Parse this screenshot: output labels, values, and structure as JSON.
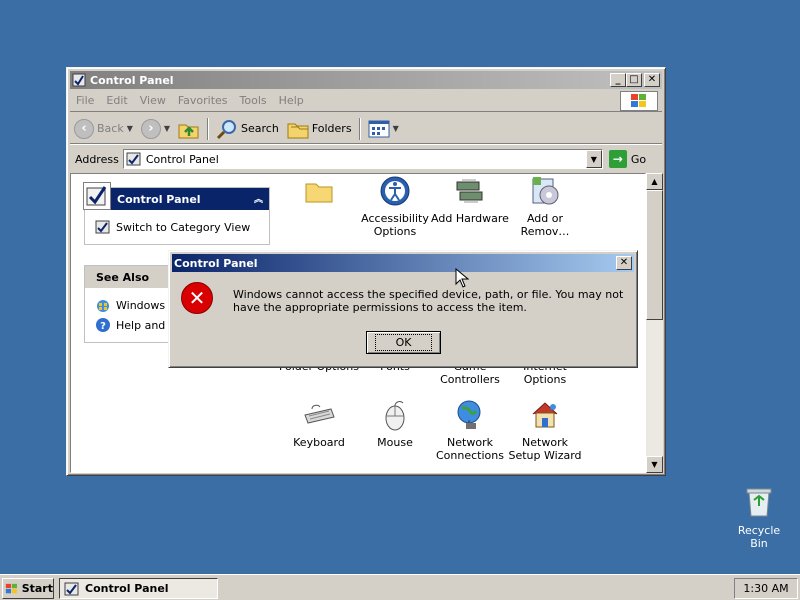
{
  "window": {
    "title": "Control Panel",
    "controls": {
      "minimize": "_",
      "maximize": "□",
      "close": "✕"
    }
  },
  "menu": [
    "File",
    "Edit",
    "View",
    "Favorites",
    "Tools",
    "Help"
  ],
  "toolbar": {
    "back": "Back",
    "search": "Search",
    "folders": "Folders"
  },
  "address": {
    "label": "Address",
    "value": "Control Panel",
    "go": "Go"
  },
  "task_panes": {
    "control_panel": {
      "title": "Control Panel",
      "link": "Switch to Category View"
    },
    "see_also": {
      "title": "See Also",
      "links": [
        "Windows U",
        "Help and S"
      ]
    }
  },
  "items": [
    {
      "label": "",
      "icon": "folder-icon"
    },
    {
      "label": "Accessibility Options",
      "icon": "accessibility-icon"
    },
    {
      "label": "Add Hardware",
      "icon": "add-hardware-icon"
    },
    {
      "label": "Add or Remov…",
      "icon": "add-remove-programs-icon"
    },
    {
      "label": "Folder Options",
      "icon": "folder-options-icon"
    },
    {
      "label": "Fonts",
      "icon": "fonts-icon"
    },
    {
      "label": "Game Controllers",
      "icon": "game-controllers-icon"
    },
    {
      "label": "Internet Options",
      "icon": "internet-options-icon"
    },
    {
      "label": "Keyboard",
      "icon": "keyboard-icon"
    },
    {
      "label": "Mouse",
      "icon": "mouse-icon"
    },
    {
      "label": "Network Connections",
      "icon": "network-connections-icon"
    },
    {
      "label": "Network Setup Wizard",
      "icon": "network-setup-wizard-icon"
    }
  ],
  "dialog": {
    "title": "Control Panel",
    "message": "Windows cannot access the specified device, path, or file.  You may not have the appropriate permissions to access the item.",
    "ok": "OK"
  },
  "desktop": {
    "recycle_bin": "Recycle Bin"
  },
  "taskbar": {
    "start": "Start",
    "task": "Control Panel",
    "clock": "1:30 AM"
  },
  "colors": {
    "desktop": "#3a6ea5",
    "active_title": "#0a246a",
    "inactive_title": "#808080",
    "error_icon": "#d80000"
  }
}
